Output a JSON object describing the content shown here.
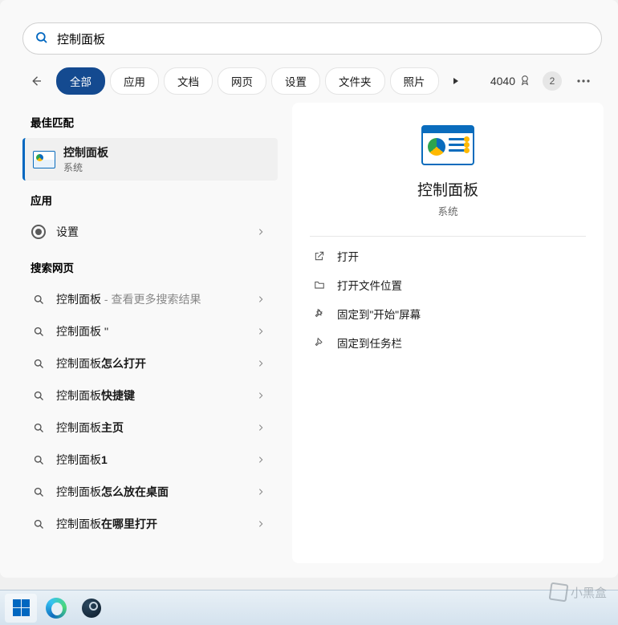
{
  "search": {
    "value": "控制面板",
    "placeholder": ""
  },
  "filters": {
    "items": [
      "全部",
      "应用",
      "文档",
      "网页",
      "设置",
      "文件夹",
      "照片"
    ],
    "active_index": 0
  },
  "rewards": {
    "points": "4040",
    "notif_count": "2"
  },
  "sections": {
    "best_match": "最佳匹配",
    "apps": "应用",
    "web": "搜索网页"
  },
  "best_match_item": {
    "title": "控制面板",
    "subtitle": "系统"
  },
  "apps_list": [
    {
      "label": "设置",
      "icon": "gear-icon"
    }
  ],
  "web_list": [
    {
      "prefix": "控制面板",
      "muted": " - 查看更多搜索结果",
      "bold": ""
    },
    {
      "prefix": "控制面板 ''",
      "muted": "",
      "bold": ""
    },
    {
      "prefix": "控制面板",
      "muted": "",
      "bold": "怎么打开"
    },
    {
      "prefix": "控制面板",
      "muted": "",
      "bold": "快捷键"
    },
    {
      "prefix": "控制面板",
      "muted": "",
      "bold": "主页"
    },
    {
      "prefix": "控制面板",
      "muted": "",
      "bold": "1"
    },
    {
      "prefix": "控制面板",
      "muted": "",
      "bold": "怎么放在桌面"
    },
    {
      "prefix": "控制面板",
      "muted": "",
      "bold": "在哪里打开"
    }
  ],
  "detail": {
    "title": "控制面板",
    "subtitle": "系统",
    "actions": [
      {
        "icon": "open-icon",
        "label": "打开"
      },
      {
        "icon": "folder-icon",
        "label": "打开文件位置"
      },
      {
        "icon": "pin-icon",
        "label": "固定到\"开始\"屏幕"
      },
      {
        "icon": "pin-icon",
        "label": "固定到任务栏"
      }
    ]
  },
  "watermark": "小黑盒"
}
